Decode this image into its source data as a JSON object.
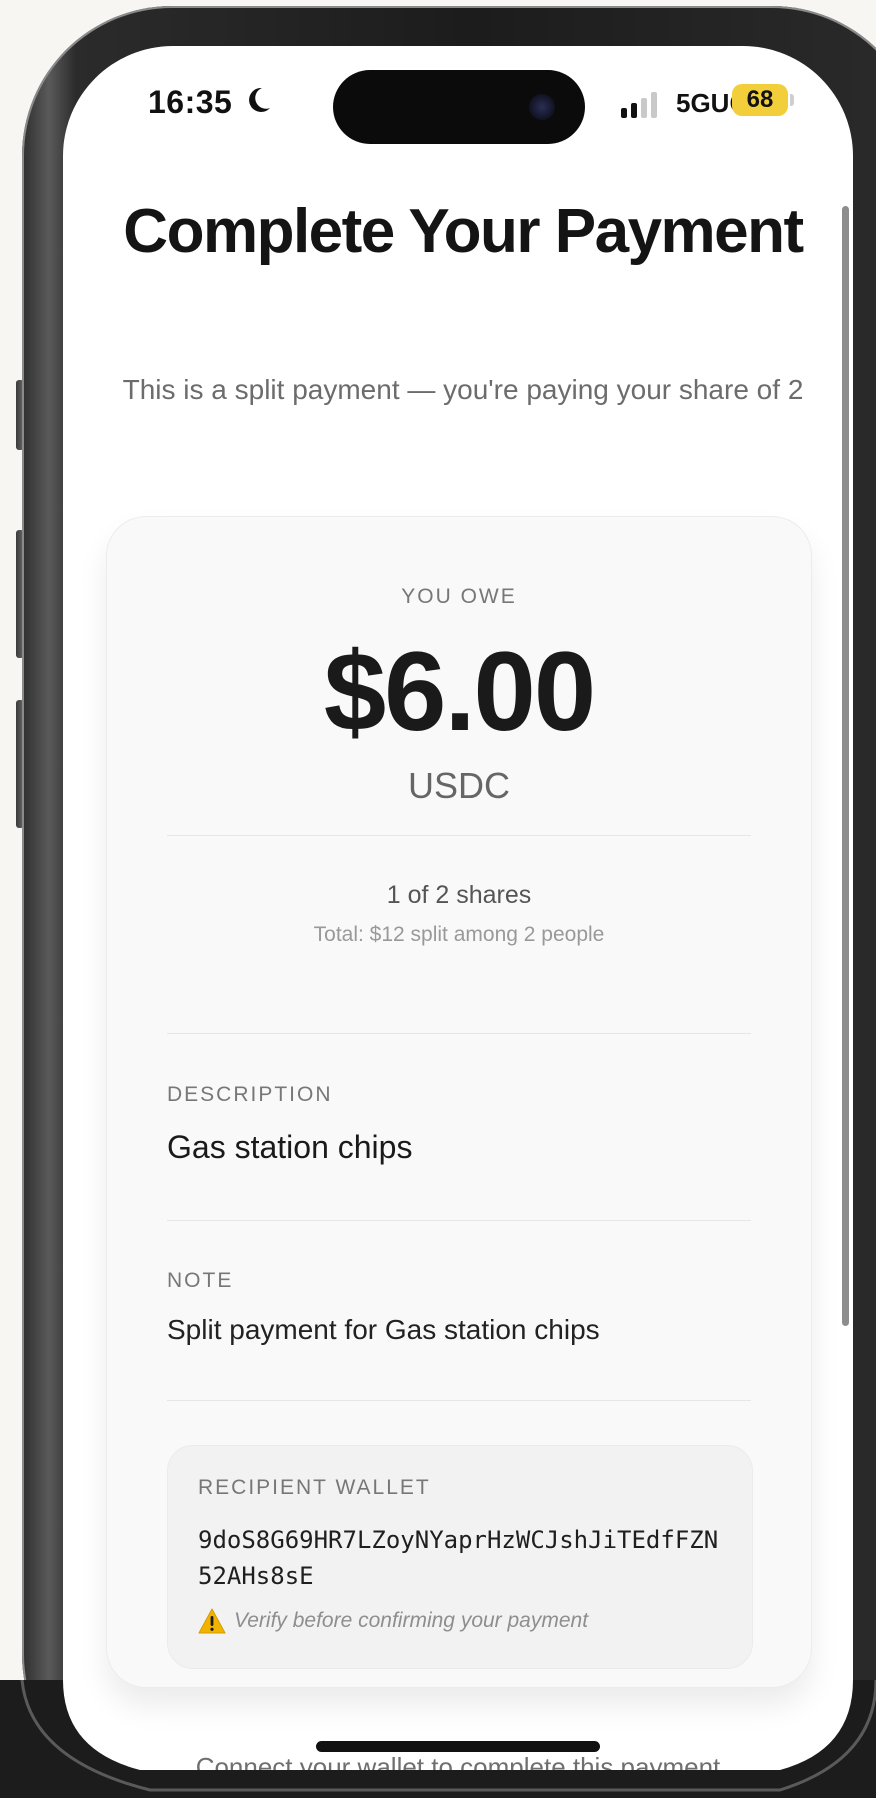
{
  "status_bar": {
    "time": "16:35",
    "network": "5GUC",
    "battery": "68"
  },
  "page": {
    "title": "Complete Your Payment",
    "subtitle": "This is a split payment — you're paying your share of 2"
  },
  "card": {
    "amount_label": "YOU OWE",
    "amount": "$6.00",
    "currency": "USDC",
    "shares": "1 of 2 shares",
    "shares_total": "Total: $12 split among 2 people",
    "description_label": "DESCRIPTION",
    "description": "Gas station chips",
    "note_label": "NOTE",
    "note": "Split payment for Gas station chips",
    "wallet": {
      "label": "RECIPIENT WALLET",
      "address": "9doS8G69HR7LZoyNYaprHzWCJshJiTEdfFZN52AHs8sE",
      "warning": "Verify before confirming your payment"
    }
  },
  "footer": {
    "text": "Connect your wallet to complete this payment"
  },
  "colors": {
    "battery": "#f2cf3a",
    "text_primary": "#1a1a1a",
    "text_muted": "#777777",
    "warning": "#f0b400"
  },
  "icons": {
    "moon": "moon-icon",
    "signal": "cellular-signal-icon",
    "warning": "warning-icon"
  }
}
